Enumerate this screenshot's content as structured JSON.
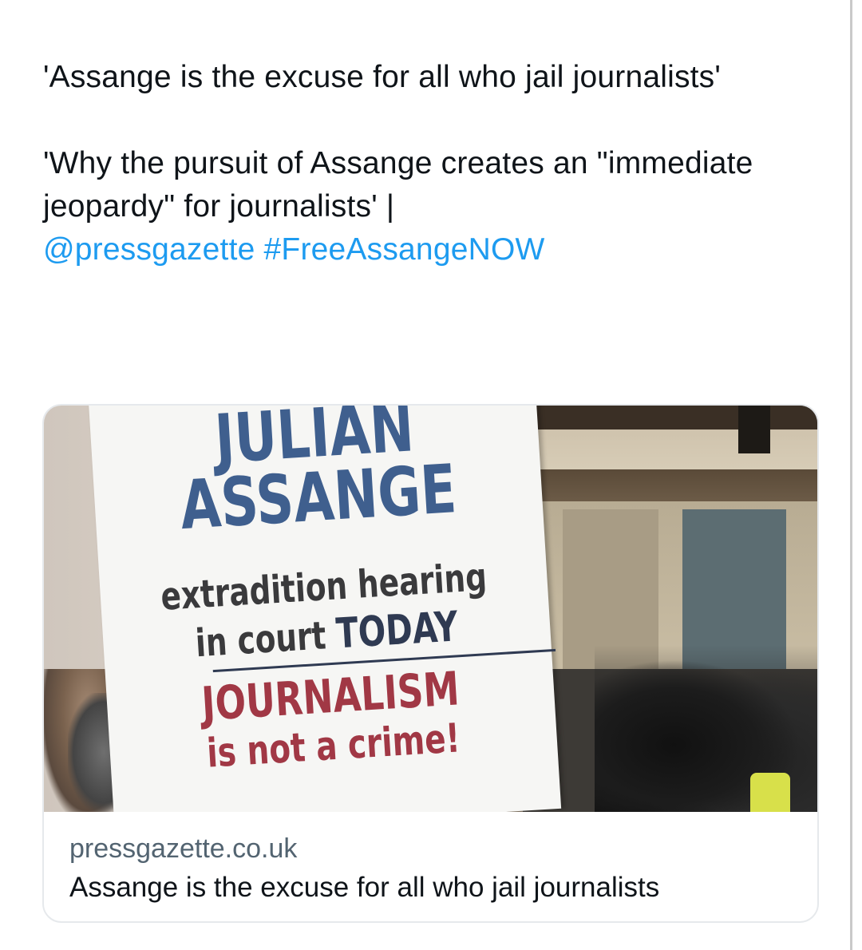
{
  "tweet": {
    "line1": "'Assange is the excuse for all who jail journalists'",
    "line2_prefix": "'Why the pursuit of Assange creates an \"immediate jeopardy\" for journalists' |",
    "mention": "@pressgazette",
    "hashtag": "#FreeAssangeNOW"
  },
  "card": {
    "placard": {
      "line1": "JULIAN",
      "line2": "ASSANGE",
      "line3": "extradition hearing",
      "line4_prefix": "in court",
      "line4_emph": "TODAY",
      "line5": "JOURNALISM",
      "line6": "is not a crime!"
    },
    "domain": "pressgazette.co.uk",
    "title": "Assange is the excuse for all who jail journalists"
  },
  "colors": {
    "link": "#1d9bf0",
    "text": "#0f1419",
    "secondary_text": "#536471"
  }
}
